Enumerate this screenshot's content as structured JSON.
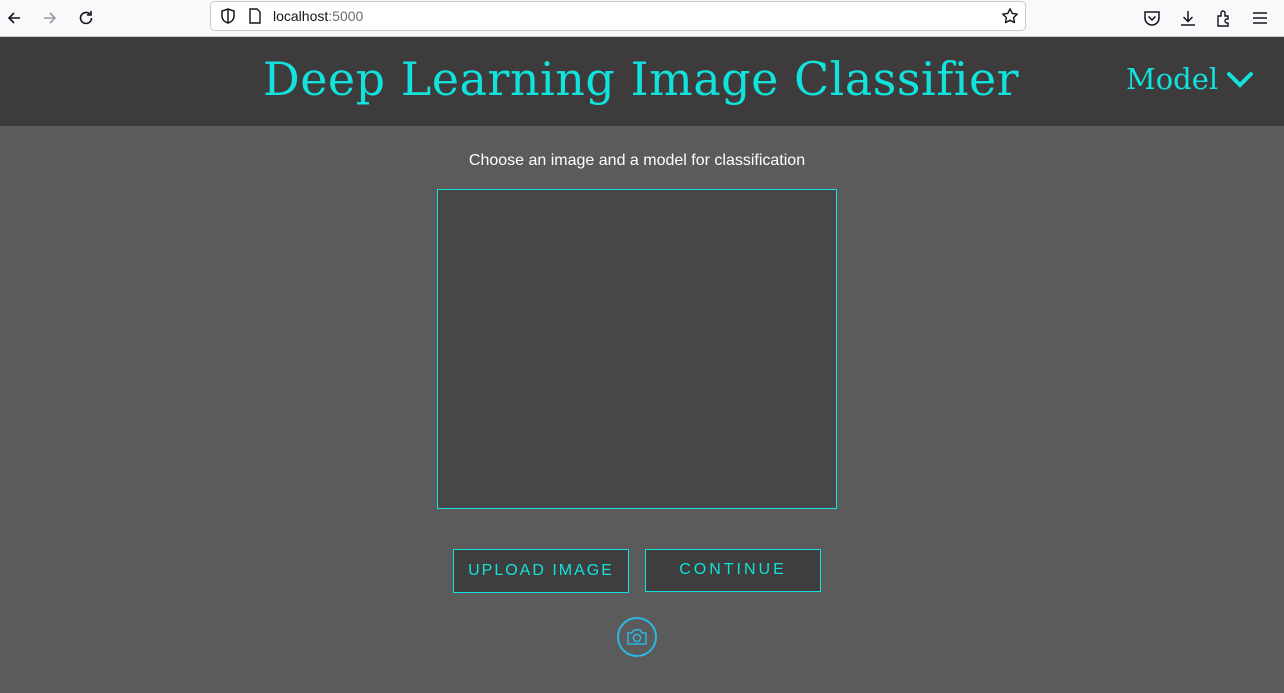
{
  "browser": {
    "url_host": "localhost",
    "url_port": ":5000",
    "icons": [
      "back-arrow-icon",
      "forward-arrow-icon",
      "reload-icon",
      "shield-icon",
      "page-icon",
      "bookmark-star-icon",
      "pocket-icon",
      "download-icon",
      "extensions-icon",
      "menu-icon"
    ]
  },
  "header": {
    "title": "Deep Learning Image Classifier",
    "model_menu_label": "Model"
  },
  "main": {
    "instruction": "Choose an image and a model for classification",
    "upload_label": "UPLOAD IMAGE",
    "continue_label": "CONTINUE"
  },
  "colors": {
    "accent": "#12e2dc",
    "header_bg": "#3d3b3c",
    "page_bg": "#5b5b5b",
    "camera": "#2bb8e6"
  }
}
